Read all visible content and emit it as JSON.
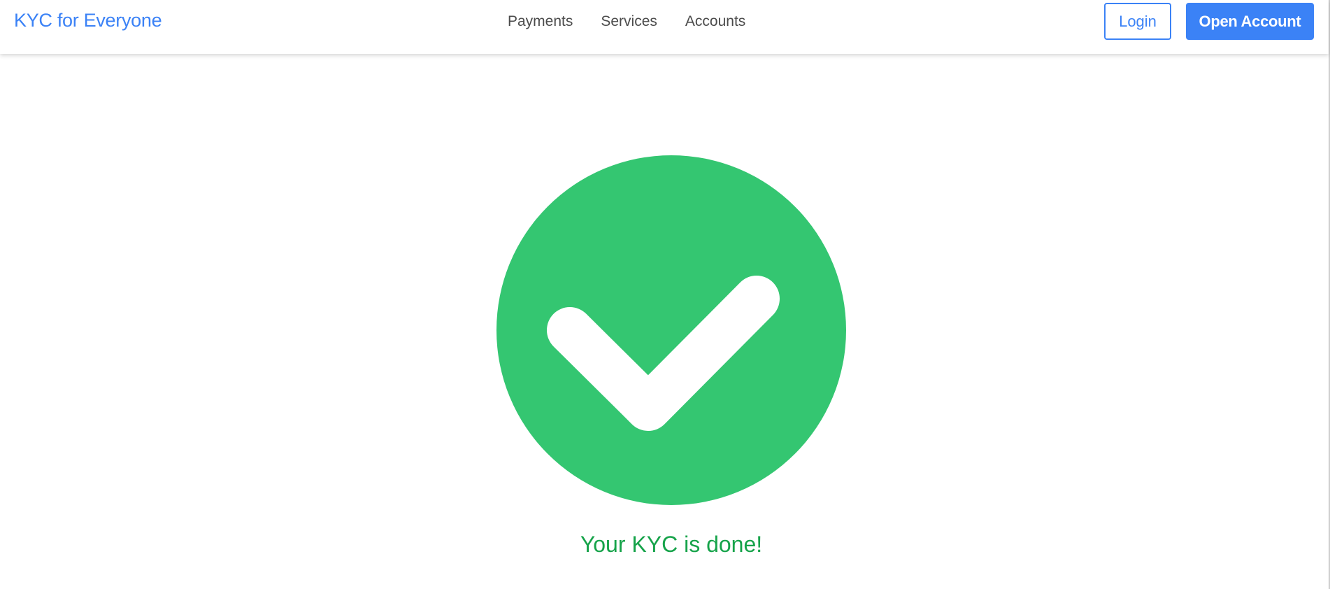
{
  "navbar": {
    "brand": "KYC for Everyone",
    "links": [
      "Payments",
      "Services",
      "Accounts"
    ],
    "login_label": "Login",
    "open_account_label": "Open Account"
  },
  "main": {
    "status_icon": "check-circle-icon",
    "message": "Your KYC is done!"
  },
  "colors": {
    "brand_blue": "#3b82f6",
    "success_green": "#34c671",
    "success_text": "#16a34a",
    "nav_text": "#4b4b4b"
  }
}
